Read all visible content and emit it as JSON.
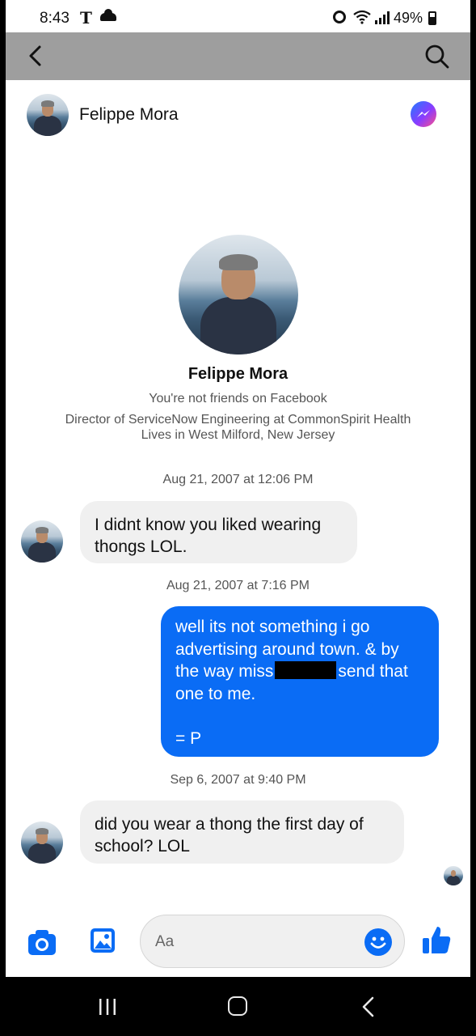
{
  "status_bar": {
    "time": "8:43",
    "carrier_icon": "T",
    "battery": "49%"
  },
  "toolbar": {
    "back_icon": "chevron-left-icon",
    "search_icon": "search-icon"
  },
  "header": {
    "name": "Felippe Mora",
    "messenger_icon": "messenger-icon"
  },
  "profile": {
    "name": "Felippe Mora",
    "friend_status": "You're not friends on Facebook",
    "work": "Director of ServiceNow Engineering at CommonSpirit Health",
    "location": "Lives in West Milford, New Jersey"
  },
  "messages": [
    {
      "timestamp": "Aug 21, 2007 at 12:06 PM",
      "direction": "incoming",
      "text": "I didnt know you liked wearing thongs LOL."
    },
    {
      "timestamp": "Aug 21, 2007 at 7:16 PM",
      "direction": "outgoing",
      "text_before_redaction": "well its not something i go advertising around town. & by the way miss",
      "text_after_redaction": "send that one to me.",
      "sign_off": "= P"
    },
    {
      "timestamp": "Sep 6, 2007 at 9:40 PM",
      "direction": "incoming",
      "text": "did you wear a thong the first day of school? LOL"
    }
  ],
  "composer": {
    "placeholder": "Aa",
    "camera_icon": "camera-icon",
    "gallery_icon": "image-icon",
    "emoji_icon": "emoji-icon",
    "like_icon": "thumbs-up-icon"
  },
  "colors": {
    "accent": "#0a6cf5",
    "toolbar": "#9e9e9e",
    "incoming_bubble": "#f0f0f0"
  }
}
